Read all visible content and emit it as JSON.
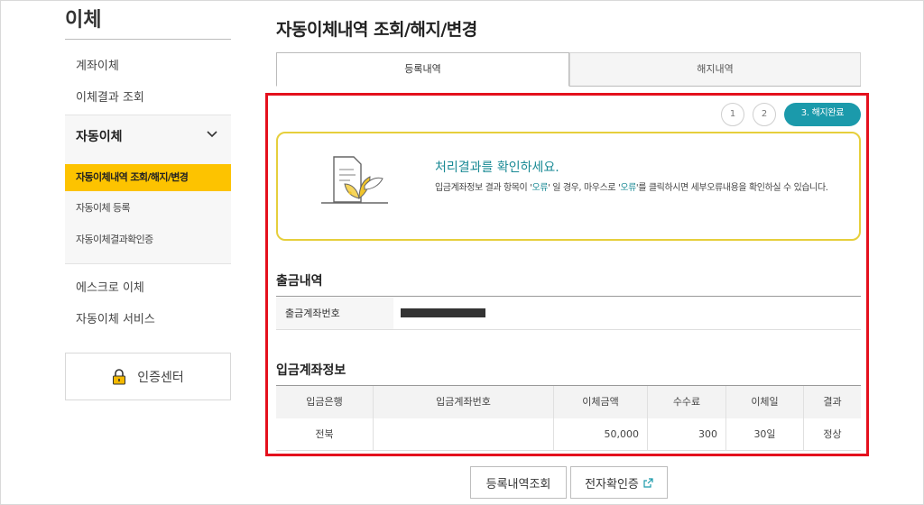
{
  "sidebar": {
    "title": "이체",
    "links_top": [
      "계좌이체",
      "이체결과 조회"
    ],
    "section": {
      "label": "자동이체",
      "items": [
        "자동이체내역 조회/해지/변경",
        "자동이체 등록",
        "자동이체결과확인증"
      ]
    },
    "links_bottom": [
      "에스크로 이체",
      "자동이체 서비스"
    ],
    "cert_center": "인증센터"
  },
  "page": {
    "title": "자동이체내역 조회/해지/변경",
    "tabs": [
      "등록내역",
      "해지내역"
    ],
    "steps": [
      "1",
      "2",
      "3. 해지완료"
    ]
  },
  "result": {
    "title": "처리결과를 확인하세요.",
    "desc_a": "입금계좌정보 결과 항목이 '",
    "err": "오류",
    "desc_b": "' 일 경우, 마우스로 '",
    "desc_c": "'를 클릭하시면 세부오류내용을 확인하실 수 있습니다."
  },
  "withdrawal": {
    "title": "출금내역",
    "account_label": "출금계좌번호"
  },
  "deposit": {
    "title": "입금계좌정보",
    "headers": [
      "입금은행",
      "입금계좌번호",
      "이체금액",
      "수수료",
      "이체일",
      "결과"
    ],
    "row": [
      "전북",
      "",
      "50,000",
      "300",
      "30일",
      "정상"
    ]
  },
  "buttons": {
    "history": "등록내역조회",
    "e_cert": "전자확인증"
  },
  "colors": {
    "accent_yellow": "#fdc300",
    "teal": "#1b9aab",
    "highlight_red": "#e4101d"
  }
}
